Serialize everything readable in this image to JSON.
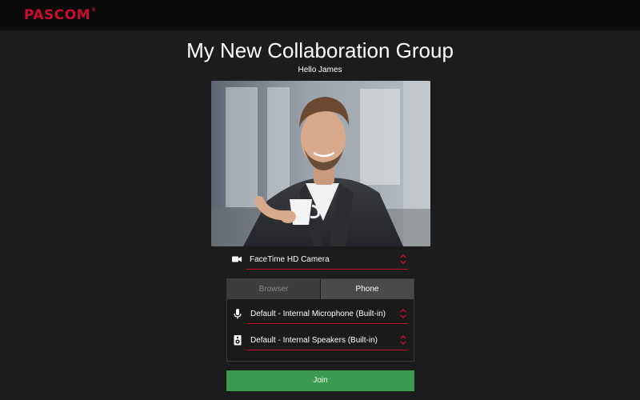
{
  "header": {
    "logo_text": "PASCOM",
    "logo_mark": "®",
    "brand_color": "#c8102e"
  },
  "page": {
    "title": "My New Collaboration Group",
    "greeting": "Hello James"
  },
  "camera": {
    "icon": "video-camera-icon",
    "selected": "FaceTime HD Camera"
  },
  "audio": {
    "tabs": [
      {
        "label": "Browser",
        "active": false
      },
      {
        "label": "Phone",
        "active": true
      }
    ],
    "microphone": {
      "icon": "microphone-icon",
      "selected": "Default - Internal Microphone (Built-in)"
    },
    "speaker": {
      "icon": "speaker-icon",
      "selected": "Default - Internal Speakers (Built-in)"
    }
  },
  "join": {
    "label": "Join",
    "color": "#3a9a4e"
  }
}
